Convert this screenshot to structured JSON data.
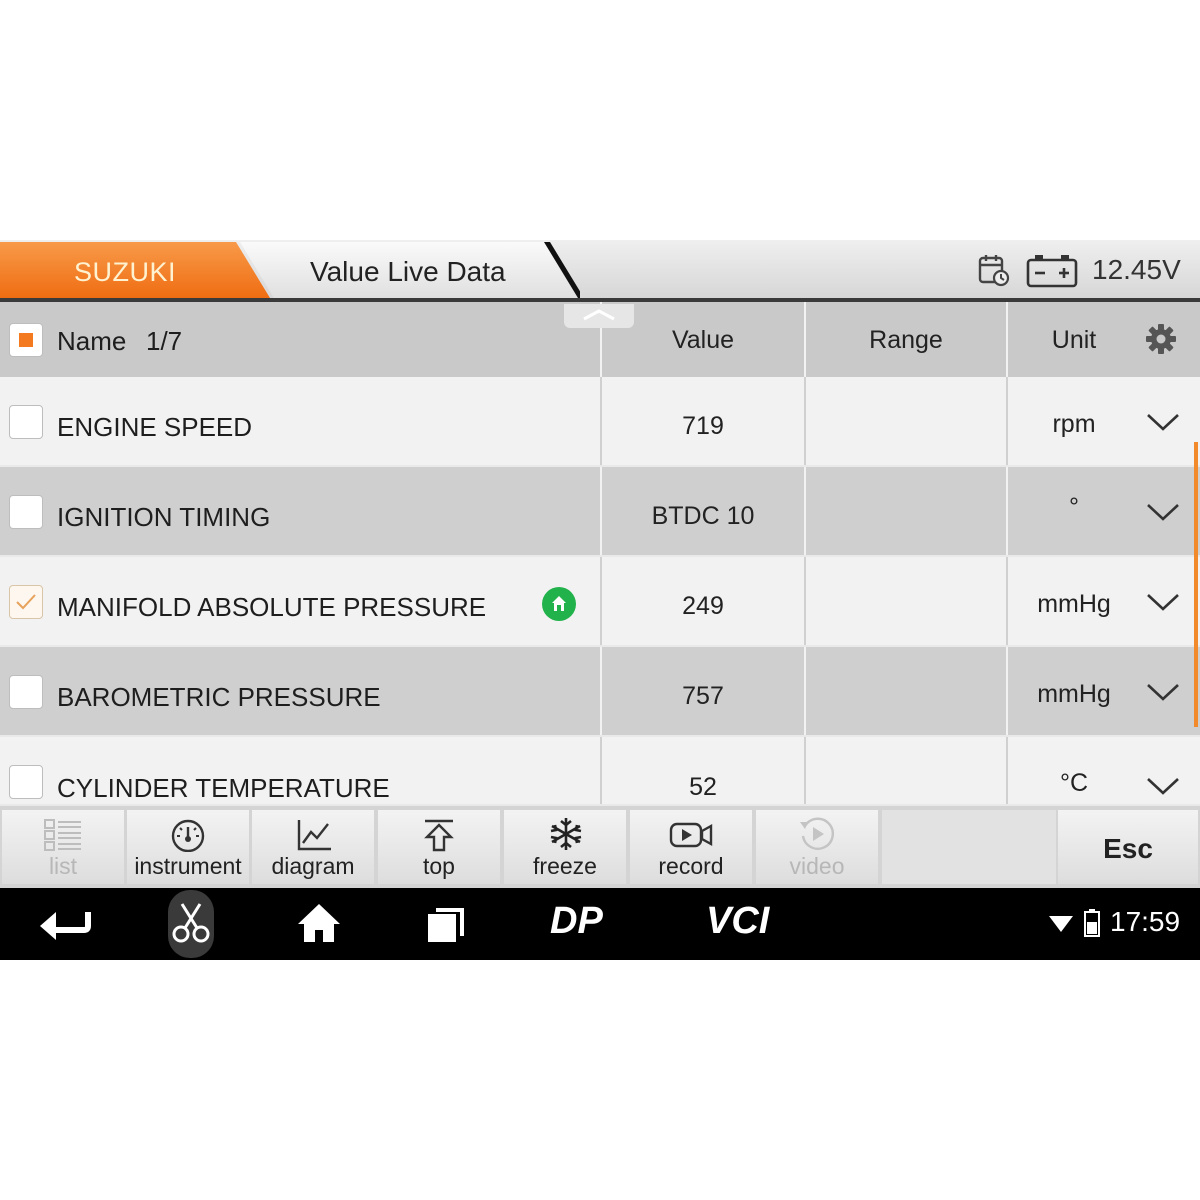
{
  "header": {
    "brand_tab": "SUZUKI",
    "title_tab": "Value Live Data",
    "voltage": "12.45V"
  },
  "table": {
    "columns": {
      "name": "Name",
      "page": "1/7",
      "value": "Value",
      "range": "Range",
      "unit": "Unit"
    },
    "rows": [
      {
        "name": "ENGINE SPEED",
        "value": "719",
        "range": "",
        "unit": "rpm",
        "checked": false
      },
      {
        "name": "IGNITION TIMING",
        "value": "BTDC 10",
        "range": "",
        "unit": "°",
        "checked": false
      },
      {
        "name": "MANIFOLD ABSOLUTE PRESSURE",
        "value": "249",
        "range": "",
        "unit": "mmHg",
        "checked": true
      },
      {
        "name": "BAROMETRIC PRESSURE",
        "value": "757",
        "range": "",
        "unit": "mmHg",
        "checked": false
      },
      {
        "name": "CYLINDER TEMPERATURE",
        "value": "52",
        "range": "",
        "unit": "°C",
        "checked": false
      }
    ]
  },
  "toolbar": {
    "list": "list",
    "instrument": "instrument",
    "diagram": "diagram",
    "top": "top",
    "freeze": "freeze",
    "record": "record",
    "video": "video",
    "esc": "Esc"
  },
  "navbar": {
    "dp_label": "DP",
    "vci_label": "VCI",
    "time": "17:59"
  },
  "colors": {
    "brand_orange": "#f47a20",
    "accent_green": "#21b24b",
    "row_light": "#f2f2f2",
    "row_dark": "#cfcfcf"
  }
}
